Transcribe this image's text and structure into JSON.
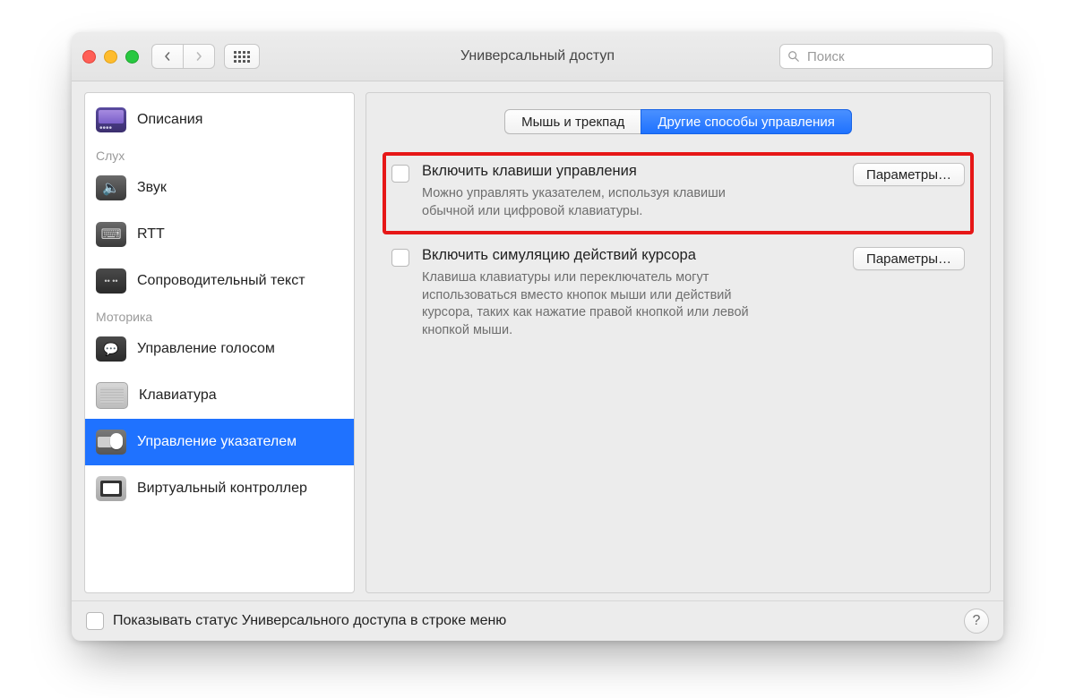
{
  "window_title": "Универсальный доступ",
  "search_placeholder": "Поиск",
  "sidebar": {
    "categories": [
      {
        "key": null,
        "items": [
          {
            "label": "Описания",
            "icon": "descriptions-icon"
          }
        ]
      },
      {
        "key": "Слух",
        "items": [
          {
            "label": "Звук",
            "icon": "sound-icon"
          },
          {
            "label": "RTT",
            "icon": "rtt-icon"
          },
          {
            "label": "Сопроводительный текст",
            "icon": "captions-icon"
          }
        ]
      },
      {
        "key": "Моторика",
        "items": [
          {
            "label": "Управление голосом",
            "icon": "voice-control-icon"
          },
          {
            "label": "Клавиатура",
            "icon": "keyboard-icon"
          },
          {
            "label": "Управление указателем",
            "icon": "pointer-control-icon",
            "selected": true
          },
          {
            "label": "Виртуальный контроллер",
            "icon": "virtual-controller-icon"
          }
        ]
      }
    ]
  },
  "tabs": {
    "mouse_trackpad": "Мышь и трекпад",
    "alt_control": "Другие способы управления"
  },
  "options": {
    "mouse_keys": {
      "title": "Включить клавиши управления",
      "desc": "Можно управлять указателем, используя клавиши обычной или цифровой клавиатуры.",
      "params": "Параметры…"
    },
    "cursor_sim": {
      "title": "Включить симуляцию действий курсора",
      "desc": "Клавиша клавиатуры или переключатель могут использоваться вместо кнопок мыши или действий курсора, таких как нажатие правой кнопкой или левой кнопкой мыши.",
      "params": "Параметры…"
    }
  },
  "footer": {
    "show_status": "Показывать статус Универсального доступа в строке меню"
  }
}
